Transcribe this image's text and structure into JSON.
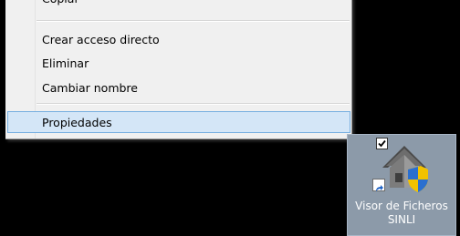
{
  "context_menu": {
    "partial_top_item": "Copiar",
    "items": [
      {
        "label": "Crear acceso directo"
      },
      {
        "label": "Eliminar"
      },
      {
        "label": "Cambiar nombre"
      },
      {
        "label": "Propiedades"
      }
    ],
    "highlighted_item": "Propiedades"
  },
  "desktop_icon": {
    "label_line1": "Visor de Ficheros",
    "label_line2": "SINLI",
    "checked": true,
    "icon": "house-with-shield-icon"
  },
  "colors": {
    "desktop_bg": "#000000",
    "menu_bg": "#f0f0f0",
    "highlight_bg": "#d4e6f7",
    "highlight_border": "#76aee0",
    "icon_selection_bg": "#8c9aa9"
  }
}
